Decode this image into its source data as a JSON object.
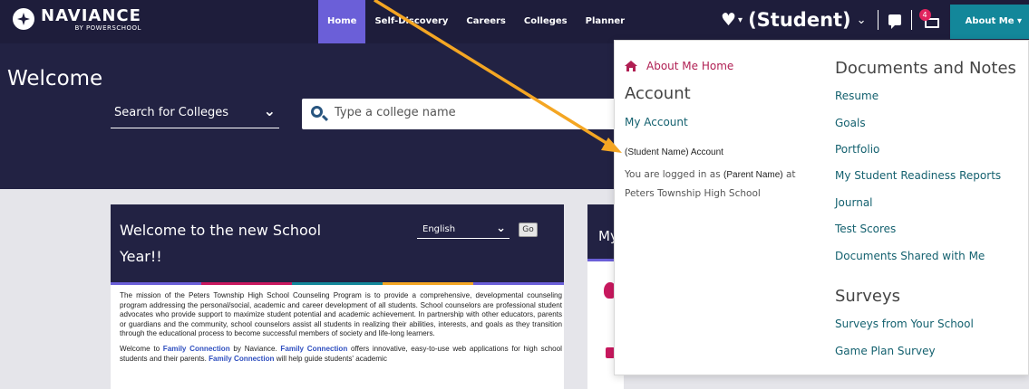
{
  "brand": {
    "name": "NAVIANCE",
    "sub": "BY POWERSCHOOL"
  },
  "nav": {
    "items": [
      {
        "label": "Home",
        "active": true
      },
      {
        "label": "Self-Discovery",
        "active": false
      },
      {
        "label": "Careers",
        "active": false
      },
      {
        "label": "Colleges",
        "active": false
      },
      {
        "label": "Planner",
        "active": false
      }
    ]
  },
  "user": {
    "student_label": "(Student)",
    "mail_count": "4",
    "about_me_button": "About Me ▾"
  },
  "hero": {
    "welcome": "Welcome",
    "search_type": "Search for Colleges",
    "search_placeholder": "Type a college name"
  },
  "welcome_card": {
    "title": "Welcome to the new School Year!!",
    "language": "English",
    "go_label": "Go",
    "paragraph1": "The mission of the Peters Township High School Counseling Program is to provide a comprehensive, developmental counseling program addressing the personal/social, academic and career development of all students. School counselors are professional student advocates who provide support to maximize student potential and academic achievement. In partnership with other educators, parents or guardians and the community, school counselors assist all students in realizing their abilities, interests, and goals as they transition through the educational process to become successful members of society and life-long learners.",
    "p2_prefix": "Welcome to ",
    "p2_fc1": "Family Connection",
    "p2_mid": " by Naviance. ",
    "p2_fc2": "Family Connection",
    "p2_mid2": " offers innovative, easy-to-use web applications for high school students and their parents. ",
    "p2_fc3": "Family Connection",
    "p2_suffix": " will help guide students' academic"
  },
  "card2": {
    "title_fragment": "My"
  },
  "dropdown": {
    "about_me_home": "About Me Home",
    "account_heading": "Account",
    "my_account": "My Account",
    "student_account": "(Student Name) Account",
    "logged_in_prefix": "You are logged in as",
    "logged_in_name": "(Parent Name)",
    "logged_in_at": "at",
    "school": "Peters Township High School",
    "documents_heading": "Documents and Notes",
    "documents_links": [
      "Resume",
      "Goals",
      "Portfolio",
      "My Student Readiness Reports",
      "Journal",
      "Test Scores",
      "Documents Shared with Me"
    ],
    "surveys_heading": "Surveys",
    "surveys_links": [
      "Surveys from Your School",
      "Game Plan Survey"
    ]
  },
  "colors": {
    "nav_bg": "#1e1d3b",
    "nav_active": "#6b5fd8",
    "about_me_teal": "#13879a",
    "accent_magenta": "#b01f53",
    "link_teal": "#14616f",
    "arrow_orange": "#f4a623"
  }
}
